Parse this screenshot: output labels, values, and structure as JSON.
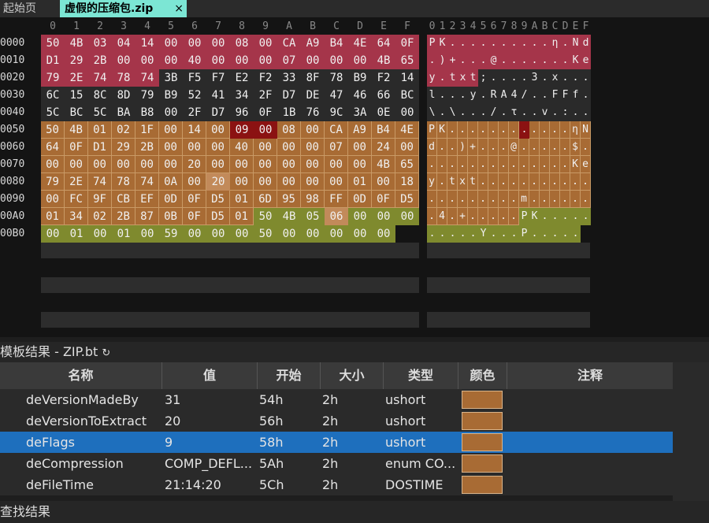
{
  "tabs": [
    {
      "label": "起始页"
    },
    {
      "label": "虚假的压缩包.zip",
      "close": "×"
    }
  ],
  "hex": {
    "columns": [
      "0",
      "1",
      "2",
      "3",
      "4",
      "5",
      "6",
      "7",
      "8",
      "9",
      "A",
      "B",
      "C",
      "D",
      "E",
      "F"
    ],
    "ascii_columns": "0123456789ABCDEF",
    "rows": [
      {
        "addr": "0000",
        "bytes": [
          "50",
          "4B",
          "03",
          "04",
          "14",
          "00",
          "00",
          "00",
          "08",
          "00",
          "CA",
          "A9",
          "B4",
          "4E",
          "64",
          "0F"
        ],
        "ascii": [
          "P",
          "K",
          ".",
          ".",
          ".",
          ".",
          ".",
          ".",
          ".",
          ".",
          ".",
          ".",
          "ƞ",
          ".",
          "N",
          "d",
          "."
        ]
      },
      {
        "addr": "0010",
        "bytes": [
          "D1",
          "29",
          "2B",
          "00",
          "00",
          "00",
          "40",
          "00",
          "00",
          "00",
          "07",
          "00",
          "00",
          "00",
          "4B",
          "65"
        ],
        "ascii": [
          ".",
          ")",
          "+",
          ".",
          ".",
          ".",
          "@",
          ".",
          ".",
          ".",
          ".",
          ".",
          ".",
          ".",
          "K",
          "e"
        ]
      },
      {
        "addr": "0020",
        "bytes": [
          "79",
          "2E",
          "74",
          "78",
          "74",
          "3B",
          "F5",
          "F7",
          "E2",
          "F2",
          "33",
          "8F",
          "78",
          "B9",
          "F2",
          "14"
        ],
        "ascii": [
          "y",
          ".",
          "t",
          "x",
          "t",
          ";",
          ".",
          ".",
          ".",
          ".",
          "3",
          ".",
          "x",
          ".",
          ".",
          "."
        ]
      },
      {
        "addr": "0030",
        "bytes": [
          "6C",
          "15",
          "8C",
          "8D",
          "79",
          "B9",
          "52",
          "41",
          "34",
          "2F",
          "D7",
          "DE",
          "47",
          "46",
          "66",
          "BC"
        ],
        "ascii": [
          "l",
          ".",
          ".",
          ".",
          "y",
          ".",
          "R",
          "A",
          "4",
          "/",
          ".",
          ".",
          "F",
          "F",
          "f",
          "."
        ]
      },
      {
        "addr": "0040",
        "bytes": [
          "5C",
          "BC",
          "5C",
          "BA",
          "B8",
          "00",
          "2F",
          "D7",
          "96",
          "0F",
          "1B",
          "76",
          "9C",
          "3A",
          "0E",
          "00"
        ],
        "ascii": [
          "\\",
          ".",
          "\\",
          ".",
          ".",
          ".",
          "/",
          ".",
          "τ",
          ".",
          ".",
          "v",
          ".",
          ":",
          ".",
          "."
        ]
      },
      {
        "addr": "0050",
        "bytes": [
          "50",
          "4B",
          "01",
          "02",
          "1F",
          "00",
          "14",
          "00",
          "09",
          "00",
          "08",
          "00",
          "CA",
          "A9",
          "B4",
          "4E"
        ],
        "ascii": [
          "P",
          "K",
          ".",
          ".",
          ".",
          ".",
          ".",
          ".",
          ".",
          ".",
          ".",
          ".",
          ".",
          ".",
          "ƞ",
          "N"
        ]
      },
      {
        "addr": "0060",
        "bytes": [
          "64",
          "0F",
          "D1",
          "29",
          "2B",
          "00",
          "00",
          "00",
          "40",
          "00",
          "00",
          "00",
          "07",
          "00",
          "24",
          "00"
        ],
        "ascii": [
          "d",
          ".",
          ".",
          ")",
          "+",
          ".",
          ".",
          ".",
          "@",
          ".",
          ".",
          ".",
          ".",
          ".",
          "$",
          "."
        ]
      },
      {
        "addr": "0070",
        "bytes": [
          "00",
          "00",
          "00",
          "00",
          "00",
          "00",
          "20",
          "00",
          "00",
          "00",
          "00",
          "00",
          "00",
          "00",
          "4B",
          "65"
        ],
        "ascii": [
          ".",
          ".",
          ".",
          ".",
          ".",
          ".",
          ".",
          ".",
          ".",
          ".",
          ".",
          ".",
          ".",
          ".",
          "K",
          "e"
        ]
      },
      {
        "addr": "0080",
        "bytes": [
          "79",
          "2E",
          "74",
          "78",
          "74",
          "0A",
          "00",
          "20",
          "00",
          "00",
          "00",
          "00",
          "00",
          "01",
          "00",
          "18"
        ],
        "ascii": [
          "y",
          ".",
          "t",
          "x",
          "t",
          ".",
          ".",
          ".",
          ".",
          ".",
          ".",
          ".",
          ".",
          ".",
          ".",
          "."
        ]
      },
      {
        "addr": "0090",
        "bytes": [
          "00",
          "FC",
          "9F",
          "CB",
          "EF",
          "0D",
          "0F",
          "D5",
          "01",
          "6D",
          "95",
          "98",
          "FF",
          "0D",
          "0F",
          "D5"
        ],
        "ascii": [
          ".",
          ".",
          ".",
          ".",
          ".",
          ".",
          ".",
          ".",
          ".",
          "m",
          ".",
          ".",
          ".",
          ".",
          ".",
          "."
        ]
      },
      {
        "addr": "00A0",
        "bytes": [
          "01",
          "34",
          "02",
          "2B",
          "87",
          "0B",
          "0F",
          "D5",
          "01",
          "50",
          "4B",
          "05",
          "06",
          "00",
          "00",
          "00"
        ],
        "ascii": [
          ".",
          "4",
          ".",
          "+",
          ".",
          ".",
          ".",
          ".",
          ".",
          "P",
          "K",
          ".",
          ".",
          ".",
          ".",
          "."
        ]
      },
      {
        "addr": "00B0",
        "bytes": [
          "00",
          "01",
          "00",
          "01",
          "00",
          "59",
          "00",
          "00",
          "00",
          "50",
          "00",
          "00",
          "00",
          "00",
          "00",
          ""
        ],
        "ascii": [
          ".",
          ".",
          ".",
          ".",
          ".",
          "Y",
          ".",
          ".",
          ".",
          "P",
          ".",
          ".",
          ".",
          ".",
          ".",
          ""
        ]
      }
    ]
  },
  "template_panel": {
    "title": "模板结果 - ZIP.bt",
    "refresh_icon": "refresh-icon",
    "columns": [
      "名称",
      "值",
      "开始",
      "大小",
      "类型",
      "颜色",
      "注释"
    ],
    "rows": [
      {
        "name": "deVersionMadeBy",
        "value": "31",
        "start": "54h",
        "size": "2h",
        "type": "ushort",
        "color": "#a86b34",
        "comment": ""
      },
      {
        "name": "deVersionToExtract",
        "value": "20",
        "start": "56h",
        "size": "2h",
        "type": "ushort",
        "color": "#a86b34",
        "comment": ""
      },
      {
        "name": "deFlags",
        "value": "9",
        "start": "58h",
        "size": "2h",
        "type": "ushort",
        "color": "#a86b34",
        "comment": "",
        "selected": true
      },
      {
        "name": "deCompression",
        "value": "COMP_DEFL...",
        "start": "5Ah",
        "size": "2h",
        "type": "enum CO...",
        "color": "#a86b34",
        "comment": ""
      },
      {
        "name": "deFileTime",
        "value": "21:14:20",
        "start": "5Ch",
        "size": "2h",
        "type": "DOSTIME",
        "color": "#a86b34",
        "comment": ""
      }
    ]
  },
  "find_panel": {
    "title": "查找结果"
  },
  "colors": {
    "red": "#a5354a",
    "orange": "#a86b34",
    "olive": "#7f8a2e",
    "selected": "#1e6fbd"
  }
}
